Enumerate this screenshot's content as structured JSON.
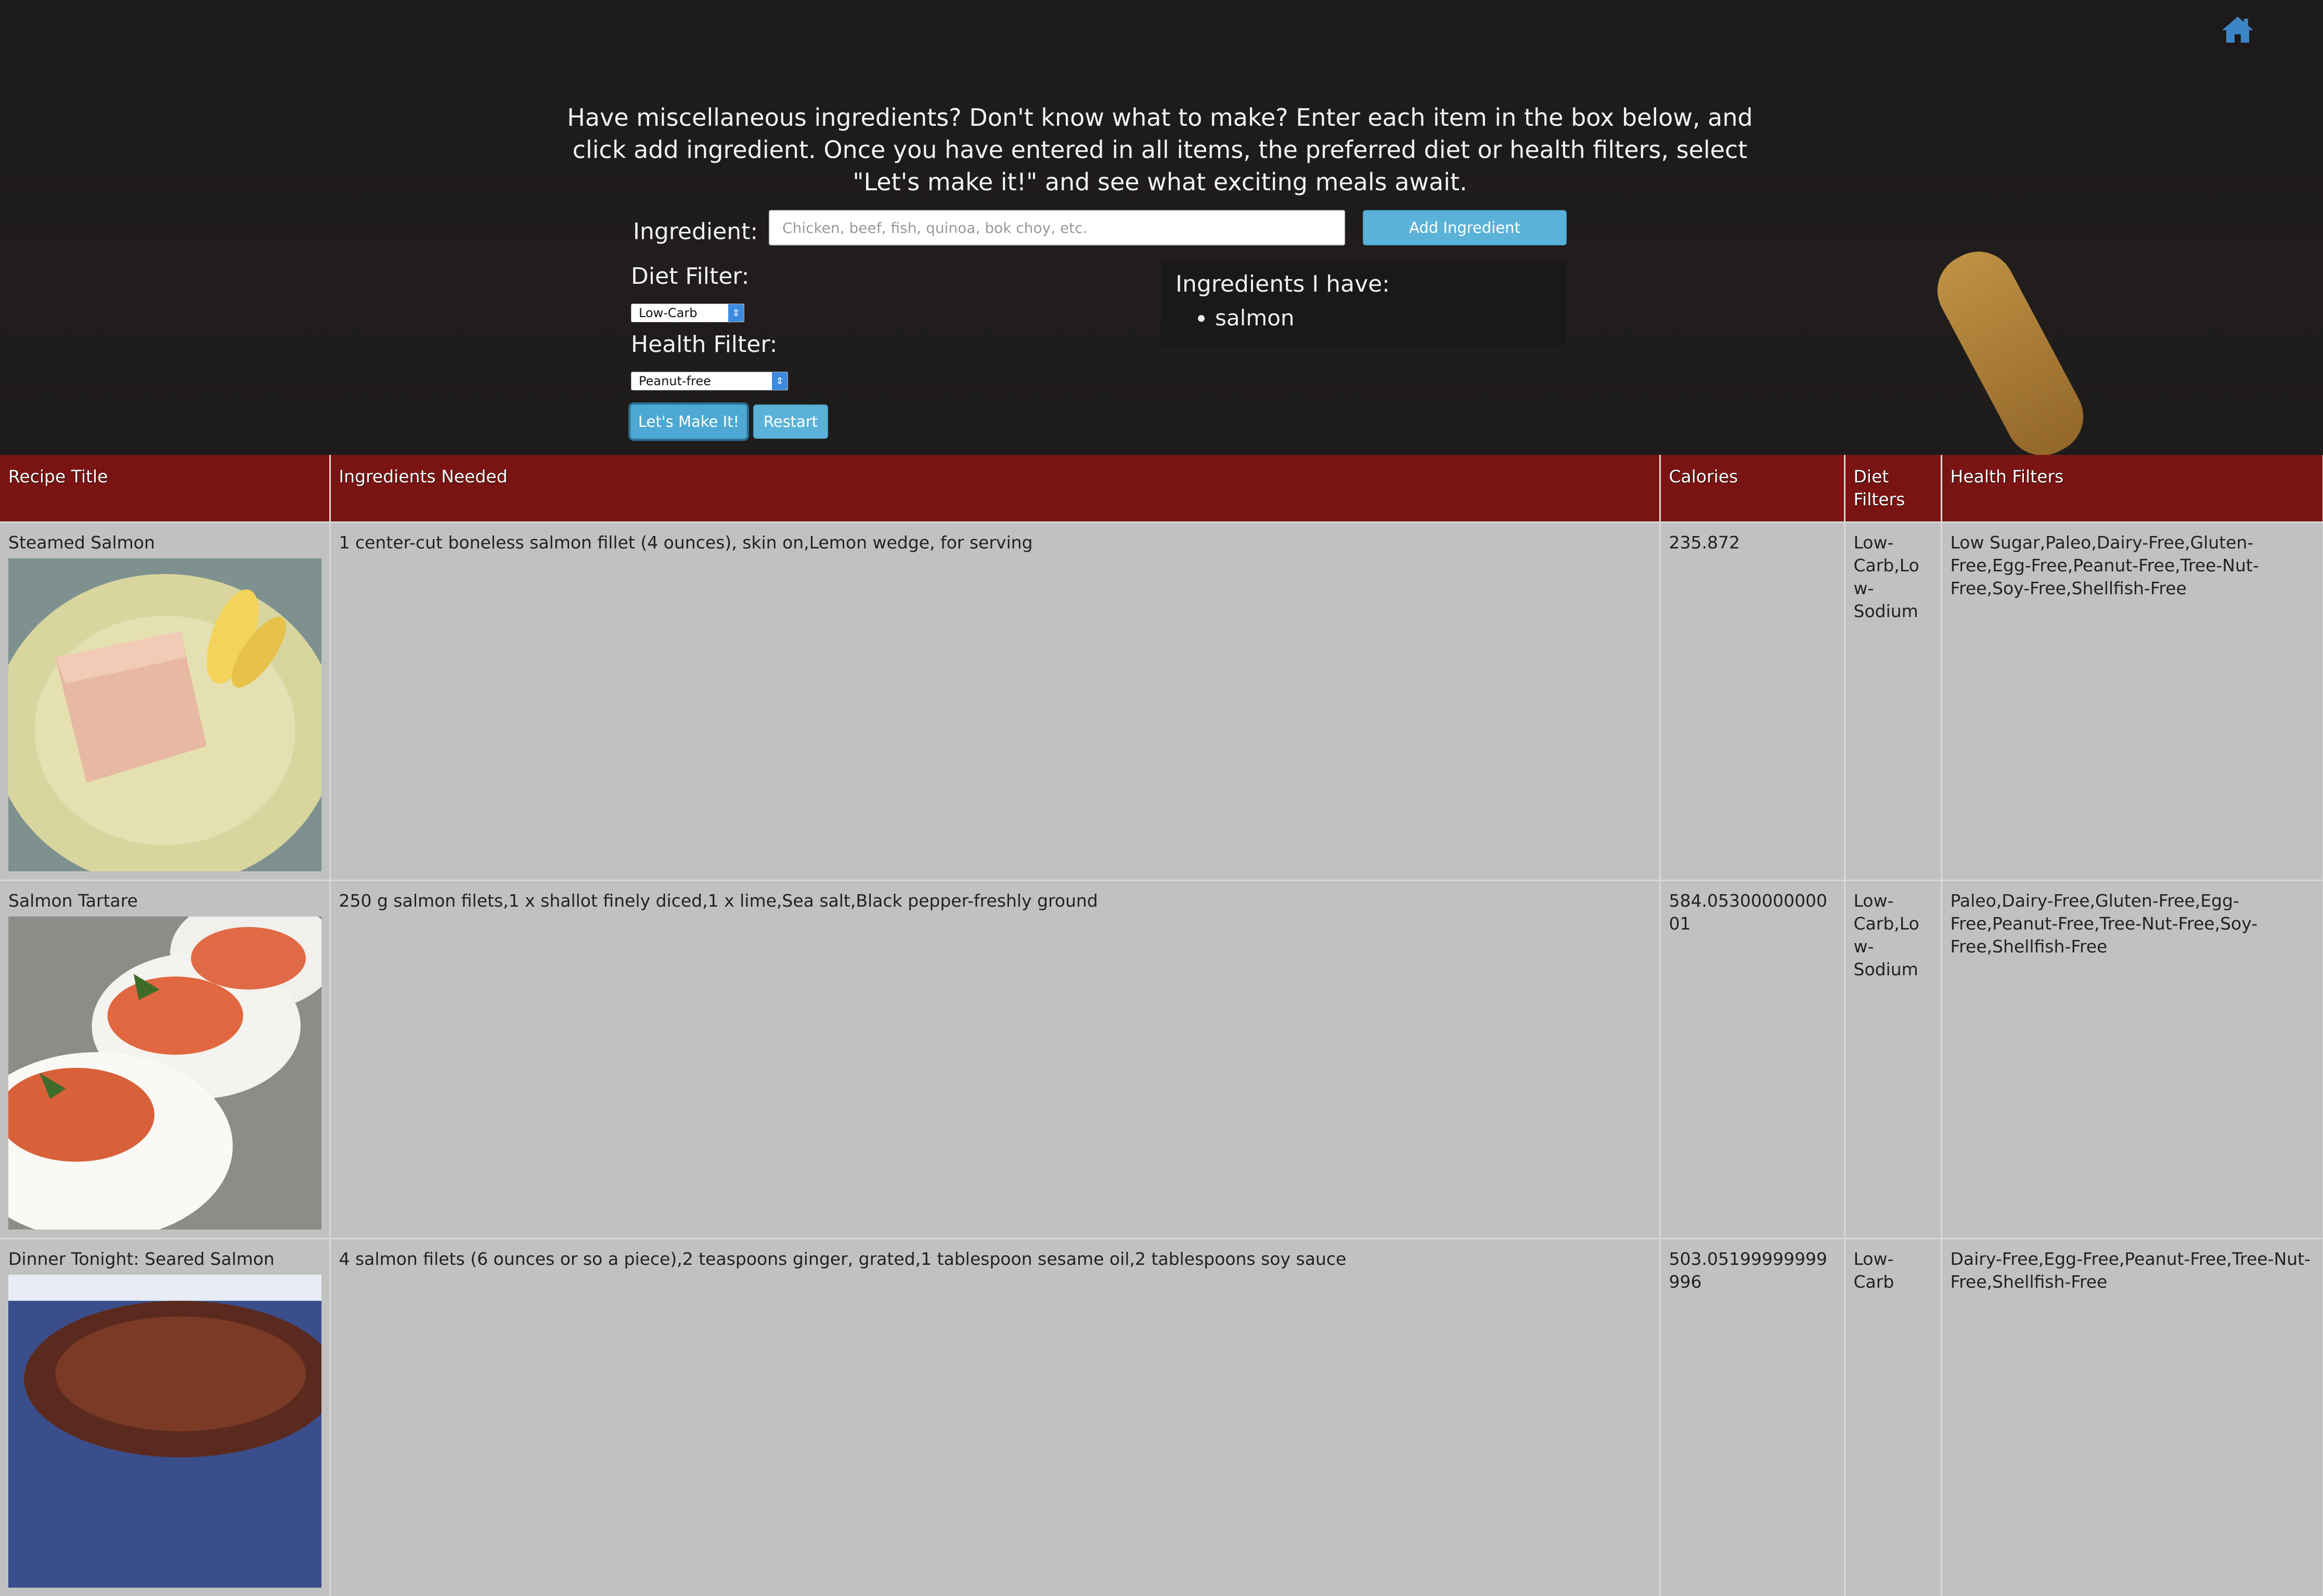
{
  "header": {
    "intro": "Have miscellaneous ingredients? Don't know what to make? Enter each item in the box below, and click add ingredient. Once you have entered in all items, the preferred diet or health filters, select \"Let's make it!\" and see what exciting meals await."
  },
  "form": {
    "ingredient_label": "Ingredient:",
    "ingredient_placeholder": "Chicken, beef, fish, quinoa, bok choy, etc.",
    "ingredient_value": "",
    "add_button": "Add Ingredient",
    "diet_label": "Diet Filter:",
    "diet_value": "Low-Carb",
    "health_label": "Health Filter:",
    "health_value": "Peanut-free",
    "make_button": "Let's Make It!",
    "restart_button": "Restart"
  },
  "have": {
    "title": "Ingredients I have:",
    "items": [
      "salmon"
    ]
  },
  "table": {
    "headers": [
      "Recipe Title",
      "Ingredients Needed",
      "Calories",
      "Diet Filters",
      "Health Filters"
    ],
    "rows": [
      {
        "title": "Steamed Salmon",
        "ingredients": "1 center-cut boneless salmon fillet (4 ounces), skin on,Lemon wedge, for serving",
        "calories": "235.872",
        "diet": "Low-Carb,Low-Sodium",
        "health": "Low Sugar,Paleo,Dairy-Free,Gluten-Free,Egg-Free,Peanut-Free,Tree-Nut-Free,Soy-Free,Shellfish-Free"
      },
      {
        "title": "Salmon Tartare",
        "ingredients": "250 g salmon filets,1 x shallot finely diced,1 x lime,Sea salt,Black pepper-freshly ground",
        "calories": "584.0530000000001",
        "diet": "Low-Carb,Low-Sodium",
        "health": "Paleo,Dairy-Free,Gluten-Free,Egg-Free,Peanut-Free,Tree-Nut-Free,Soy-Free,Shellfish-Free"
      },
      {
        "title": "Dinner Tonight: Seared Salmon",
        "ingredients": "4 salmon filets (6 ounces or so a piece),2 teaspoons ginger, grated,1 tablespoon sesame oil,2 tablespoons soy sauce",
        "calories": "503.05199999999996",
        "diet": "Low-Carb",
        "health": "Dairy-Free,Egg-Free,Peanut-Free,Tree-Nut-Free,Shellfish-Free"
      }
    ]
  },
  "icons": {
    "home": "home-icon",
    "select_caret": "chevron-updown-icon"
  },
  "colors": {
    "header_row": "#7a1412",
    "button": "#5bb2d8",
    "table_bg": "#c1c1c1",
    "home_icon": "#3d85c6"
  }
}
